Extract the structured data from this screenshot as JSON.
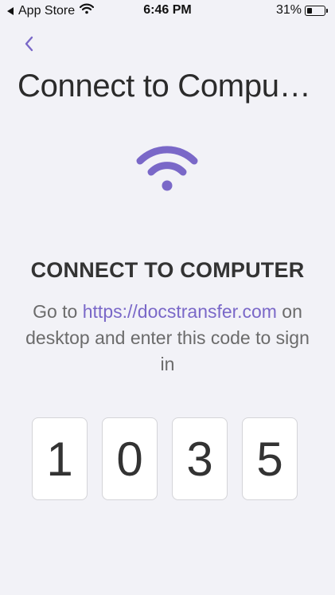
{
  "status_bar": {
    "back_app": "App Store",
    "time": "6:46 PM",
    "battery_percent": "31%",
    "battery_level": 0.31
  },
  "nav": {
    "back_icon": "chevron-left-icon"
  },
  "title": "Connect to Compu…",
  "hero_icon": "wifi-icon",
  "heading": "CONNECT TO COMPUTER",
  "instructions": {
    "prefix": "Go to ",
    "link": "https://docstransfer.com",
    "suffix": " on desktop and enter this code to sign in"
  },
  "code_digits": [
    "1",
    "0",
    "3",
    "5"
  ],
  "colors": {
    "accent": "#7a68c8",
    "background": "#f2f2f7",
    "text": "#333333"
  }
}
